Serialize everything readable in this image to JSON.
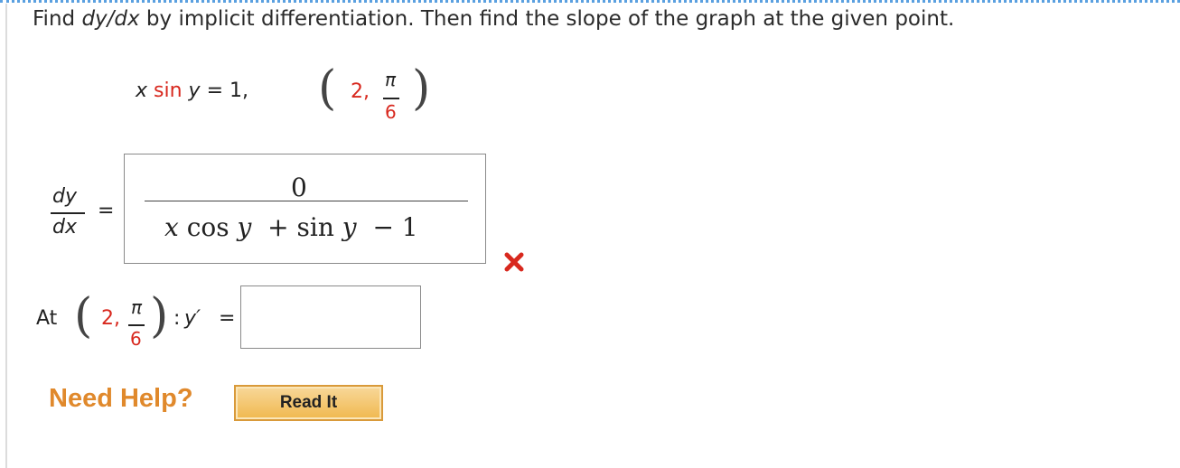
{
  "instruction": {
    "part1": "Find ",
    "expr": "dy/dx",
    "part2": " by implicit differentiation. Then find the slope of the graph at the given point."
  },
  "equation": {
    "lhs_x": "x",
    "lhs_sin": " sin ",
    "lhs_y": "y",
    "rhs": " = 1,"
  },
  "point": {
    "x": "2,",
    "num": "π",
    "den": "6"
  },
  "derivative": {
    "label_num": "dy",
    "label_den": "dx",
    "equals": "=",
    "answer_numerator": "0",
    "answer_denominator_parts": [
      "x",
      "cos",
      "y",
      "+ sin",
      "y",
      "− 1"
    ],
    "status": "incorrect"
  },
  "slope": {
    "at_label": "At",
    "point_x": "2,",
    "point_num": "π",
    "point_den": "6",
    "colon": ":",
    "yprime": "y′",
    "equals": "=",
    "value": ""
  },
  "help": {
    "label": "Need Help?",
    "read_it": "Read It"
  },
  "colors": {
    "accent_red": "#d8281e",
    "help_orange": "#e0892c",
    "dotted_border": "#5aa0e0"
  },
  "icons": {
    "wrong": "x-mark-icon"
  }
}
